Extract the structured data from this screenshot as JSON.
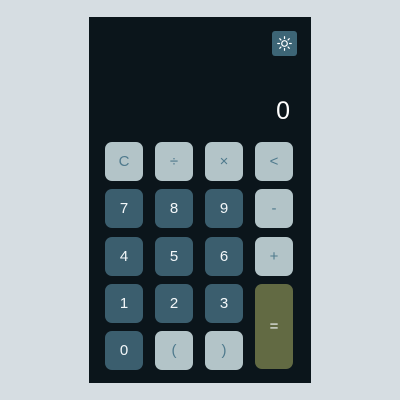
{
  "display": {
    "value": "0"
  },
  "theme_toggle": {
    "icon": "sun-icon"
  },
  "keys": {
    "clear": "C",
    "divide": "÷",
    "multiply": "×",
    "backspace": "<",
    "seven": "7",
    "eight": "8",
    "nine": "9",
    "subtract": "-",
    "four": "4",
    "five": "5",
    "six": "6",
    "add": "+",
    "one": "1",
    "two": "2",
    "three": "3",
    "equals": "=",
    "zero": "0",
    "open_paren": "(",
    "close_paren": ")"
  },
  "colors": {
    "page_background": "#d6dde2",
    "calculator_background": "#0b151b",
    "light_key": "#b3c4c8",
    "light_key_text": "#4f7a8d",
    "dark_key": "#3b5e6e",
    "dark_key_text": "#f3f7f9",
    "equals_key": "#626a43",
    "toggle_background": "#3d6576"
  }
}
